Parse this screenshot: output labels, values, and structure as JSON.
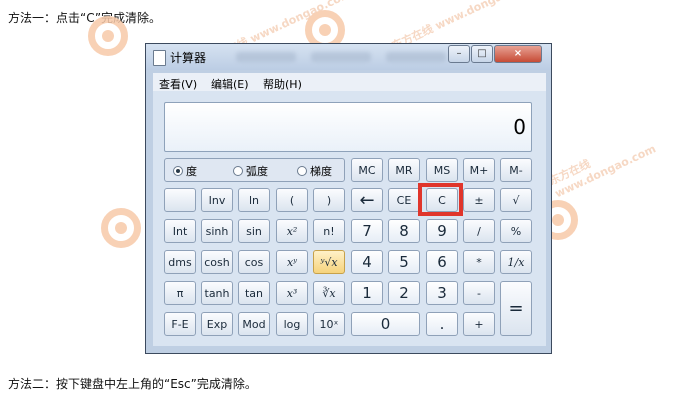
{
  "doc": {
    "line1": "方法一：点击“C”完成清除。",
    "line2": "方法二：按下键盘中左上角的“Esc”完成清除。"
  },
  "watermark": {
    "text": "东方在线 www.dongao.com"
  },
  "window": {
    "title": "计算器",
    "controls": {
      "minimize": "–",
      "maximize": "□",
      "close": "×"
    }
  },
  "menu": {
    "items": [
      "查看(V)",
      "编辑(E)",
      "帮助(H)"
    ]
  },
  "display": {
    "value": "0"
  },
  "angle_mode": {
    "options": [
      "度",
      "弧度",
      "梯度"
    ],
    "selected": "度"
  },
  "rows": [
    [
      "MC",
      "MR",
      "MS",
      "M+",
      "M-"
    ],
    [
      "",
      "Inv",
      "ln",
      "(",
      ")",
      "←",
      "CE",
      "C",
      "±",
      "√"
    ],
    [
      "Int",
      "sinh",
      "sin",
      "x²",
      "n!",
      "7",
      "8",
      "9",
      "/",
      "%"
    ],
    [
      "dms",
      "cosh",
      "cos",
      "xʸ",
      "ʸ√x",
      "4",
      "5",
      "6",
      "*",
      "1/x"
    ],
    [
      "π",
      "tanh",
      "tan",
      "x³",
      "∛x",
      "1",
      "2",
      "3",
      "-",
      "="
    ],
    [
      "F-E",
      "Exp",
      "Mod",
      "log",
      "10ˣ",
      "0",
      ".",
      "+"
    ]
  ],
  "highlight": {
    "button": "C",
    "color": "#e0352b"
  },
  "colors": {
    "window_frame": "#bfcfe3",
    "accent_button": "#f6d37c"
  }
}
